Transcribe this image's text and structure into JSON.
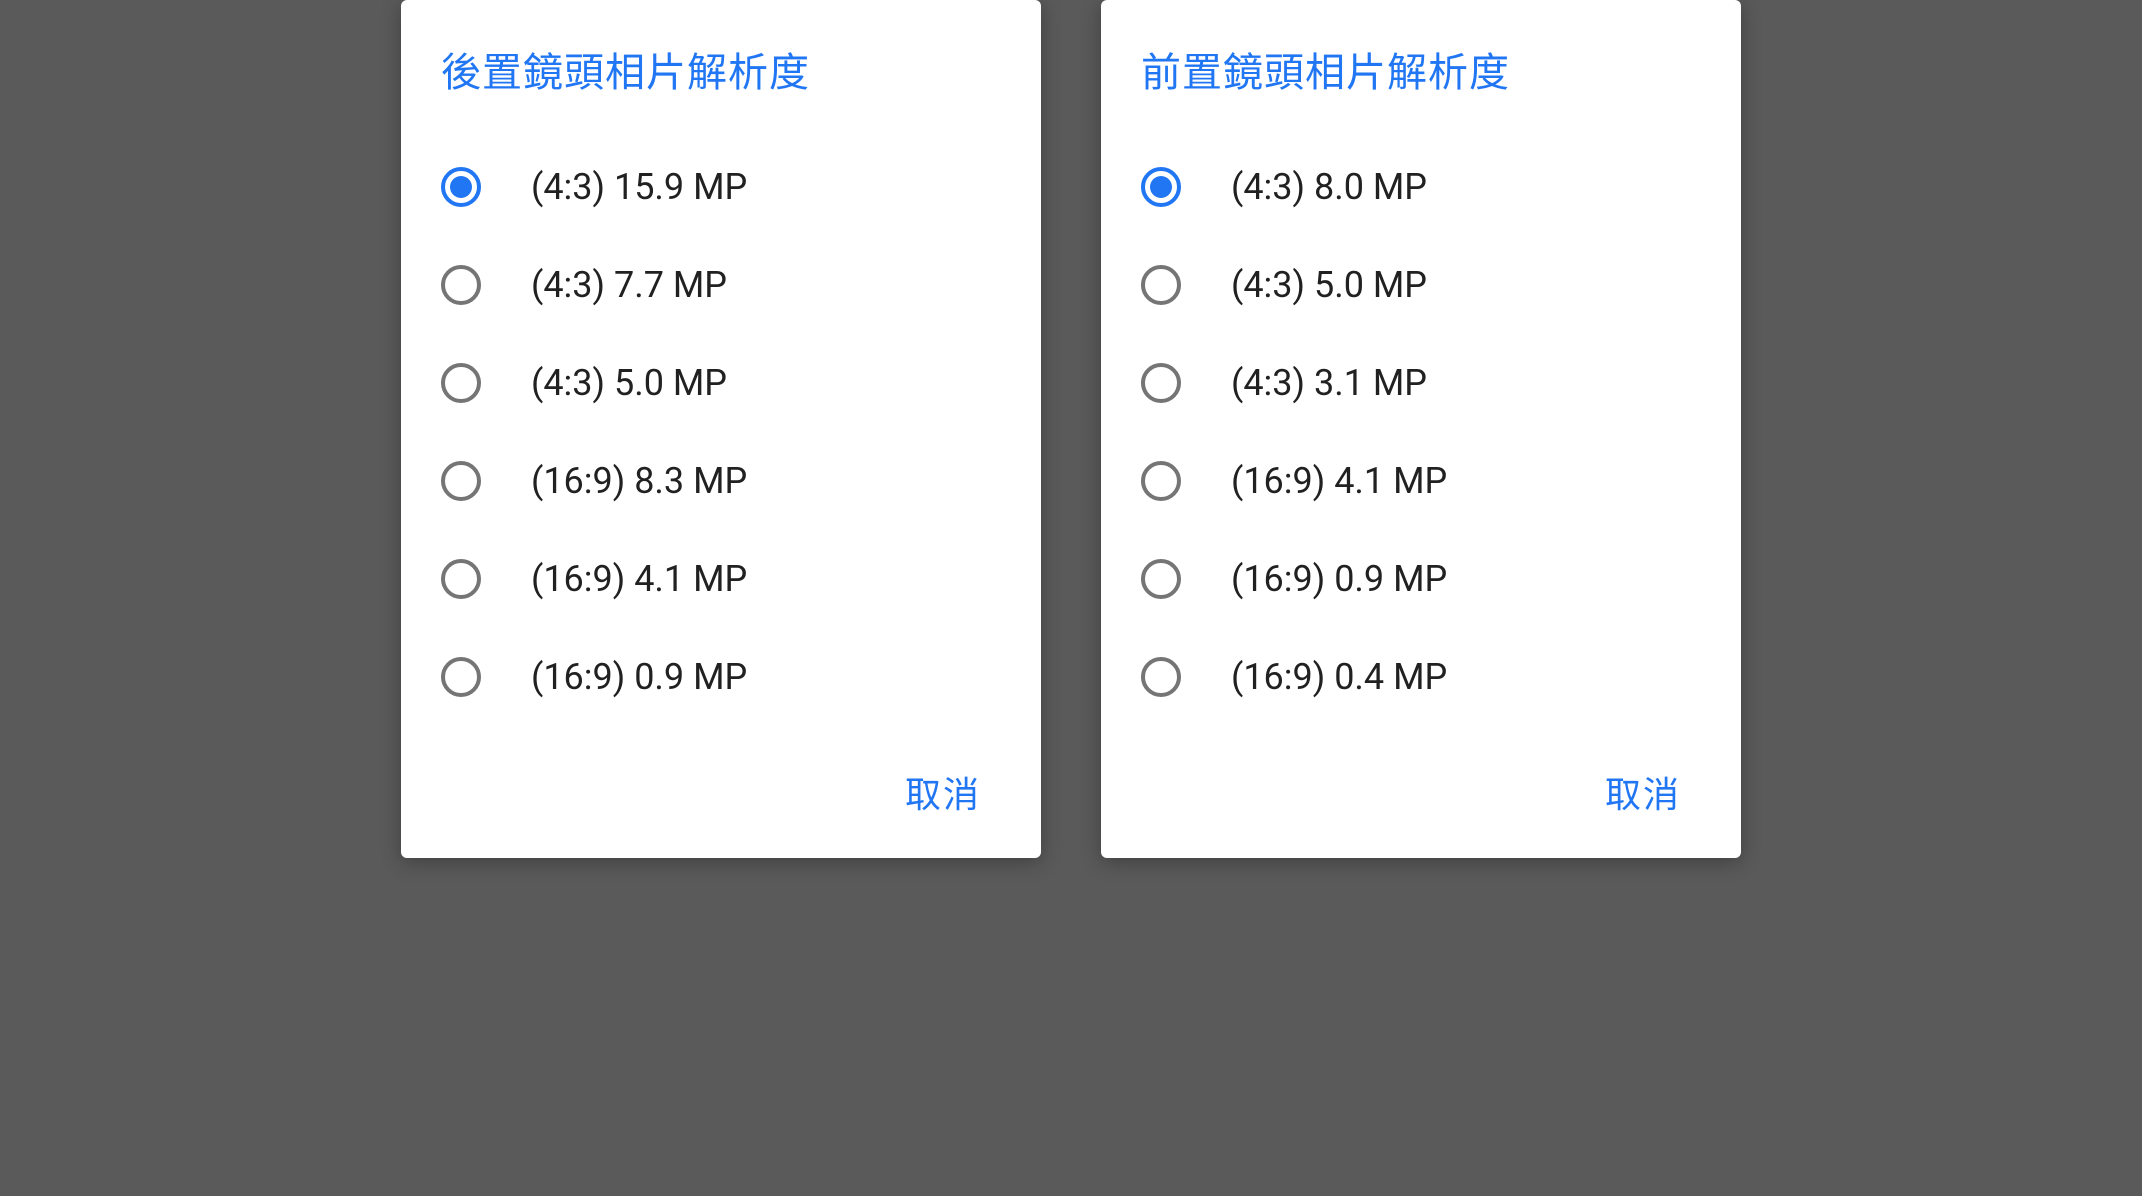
{
  "rear": {
    "title": "後置鏡頭相片解析度",
    "options": [
      {
        "label": "(4:3) 15.9 MP",
        "selected": true
      },
      {
        "label": "(4:3) 7.7 MP",
        "selected": false
      },
      {
        "label": "(4:3) 5.0 MP",
        "selected": false
      },
      {
        "label": "(16:9) 8.3 MP",
        "selected": false
      },
      {
        "label": "(16:9) 4.1 MP",
        "selected": false
      },
      {
        "label": "(16:9) 0.9 MP",
        "selected": false
      }
    ],
    "cancel_label": "取消"
  },
  "front": {
    "title": "前置鏡頭相片解析度",
    "options": [
      {
        "label": "(4:3) 8.0 MP",
        "selected": true
      },
      {
        "label": "(4:3) 5.0 MP",
        "selected": false
      },
      {
        "label": "(4:3) 3.1 MP",
        "selected": false
      },
      {
        "label": "(16:9) 4.1 MP",
        "selected": false
      },
      {
        "label": "(16:9) 0.9 MP",
        "selected": false
      },
      {
        "label": "(16:9) 0.4 MP",
        "selected": false
      }
    ],
    "cancel_label": "取消"
  }
}
